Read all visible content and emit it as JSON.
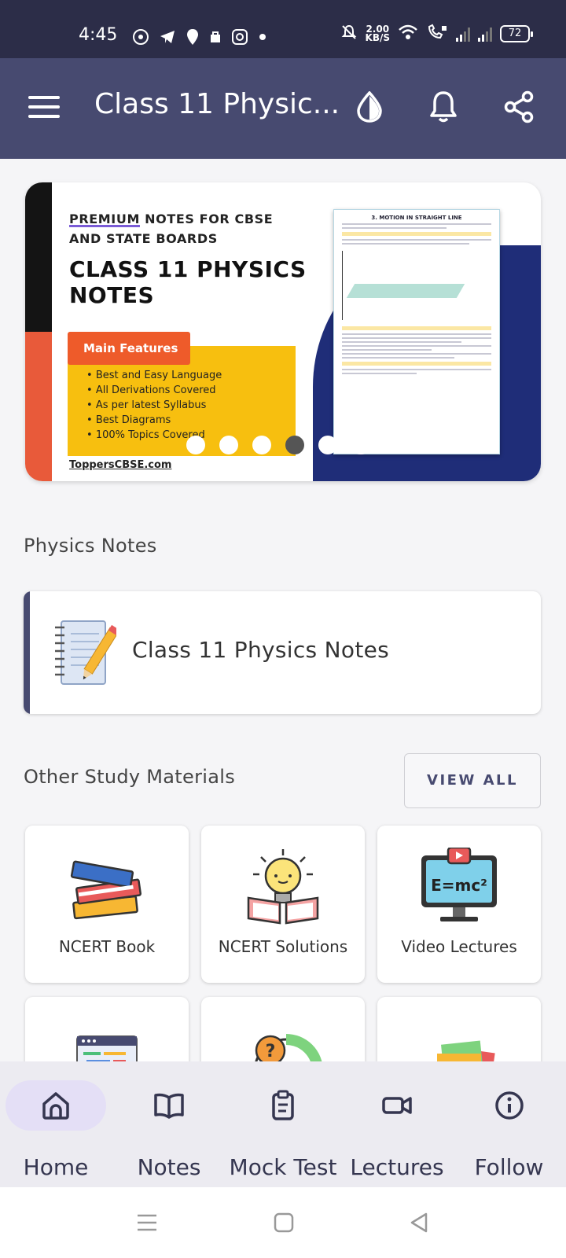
{
  "status_bar": {
    "time": "4:45",
    "net_speed_value": "2.00",
    "net_speed_unit": "KB/S",
    "battery": "72",
    "icons": [
      "whatsapp-icon",
      "telegram-icon",
      "location-icon",
      "bag-icon",
      "instagram-icon",
      "dot-icon",
      "mute-icon",
      "wifi-icon",
      "volte-icon",
      "signal-icon",
      "signal-icon",
      "battery-icon"
    ]
  },
  "app_bar": {
    "title": "Class 11 Physic...",
    "icons": [
      "menu-icon",
      "theme-icon",
      "bell-icon",
      "share-icon"
    ]
  },
  "banner": {
    "line1": "PREMIUM NOTES FOR CBSE",
    "line1_underlined": "PREMIUM",
    "line1_rest": " NOTES FOR CBSE",
    "line2": "AND STATE BOARDS",
    "heading_line1": "CLASS 11 PHYSICS",
    "heading_line2": "NOTES",
    "features_title": "Main Features",
    "features": [
      "Best and Easy Language",
      "All Derivations Covered",
      "As per latest Syllabus",
      "Best Diagrams",
      "100% Topics Covered"
    ],
    "website": "ToppersCBSE.com",
    "doc_title": "3. MOTION IN STRAIGHT LINE",
    "slide_count": 6,
    "active_slide": 4
  },
  "physics_notes": {
    "section_title": "Physics Notes",
    "card_label": "Class 11 Physics Notes",
    "card_icon": "notebook-pencil-icon"
  },
  "other_materials": {
    "section_title": "Other Study Materials",
    "view_all_label": "VIEW ALL",
    "tiles": [
      {
        "label": "NCERT Book",
        "icon": "books-stack-icon"
      },
      {
        "label": "NCERT Solutions",
        "icon": "lightbulb-book-icon"
      },
      {
        "label": "Video Lectures",
        "icon": "monitor-emc2-icon"
      },
      {
        "label": "",
        "icon": "code-window-icon"
      },
      {
        "label": "",
        "icon": "question-chart-icon"
      },
      {
        "label": "",
        "icon": "sticky-notes-icon"
      }
    ],
    "monitor_text": "E=mc²"
  },
  "bottom_nav": {
    "items": [
      {
        "label": "Home",
        "icon": "home-icon",
        "active": true
      },
      {
        "label": "Notes",
        "icon": "book-icon",
        "active": false
      },
      {
        "label": "Mock Test",
        "icon": "clipboard-icon",
        "active": false
      },
      {
        "label": "Lectures",
        "icon": "video-camera-icon",
        "active": false
      },
      {
        "label": "Follow",
        "icon": "info-icon",
        "active": false
      }
    ]
  },
  "colors": {
    "status_bar": "#2c2d48",
    "app_bar": "#474a70",
    "accent": "#474a70",
    "background": "#f5f5f7",
    "nav_active_pill": "#e4dff6"
  }
}
